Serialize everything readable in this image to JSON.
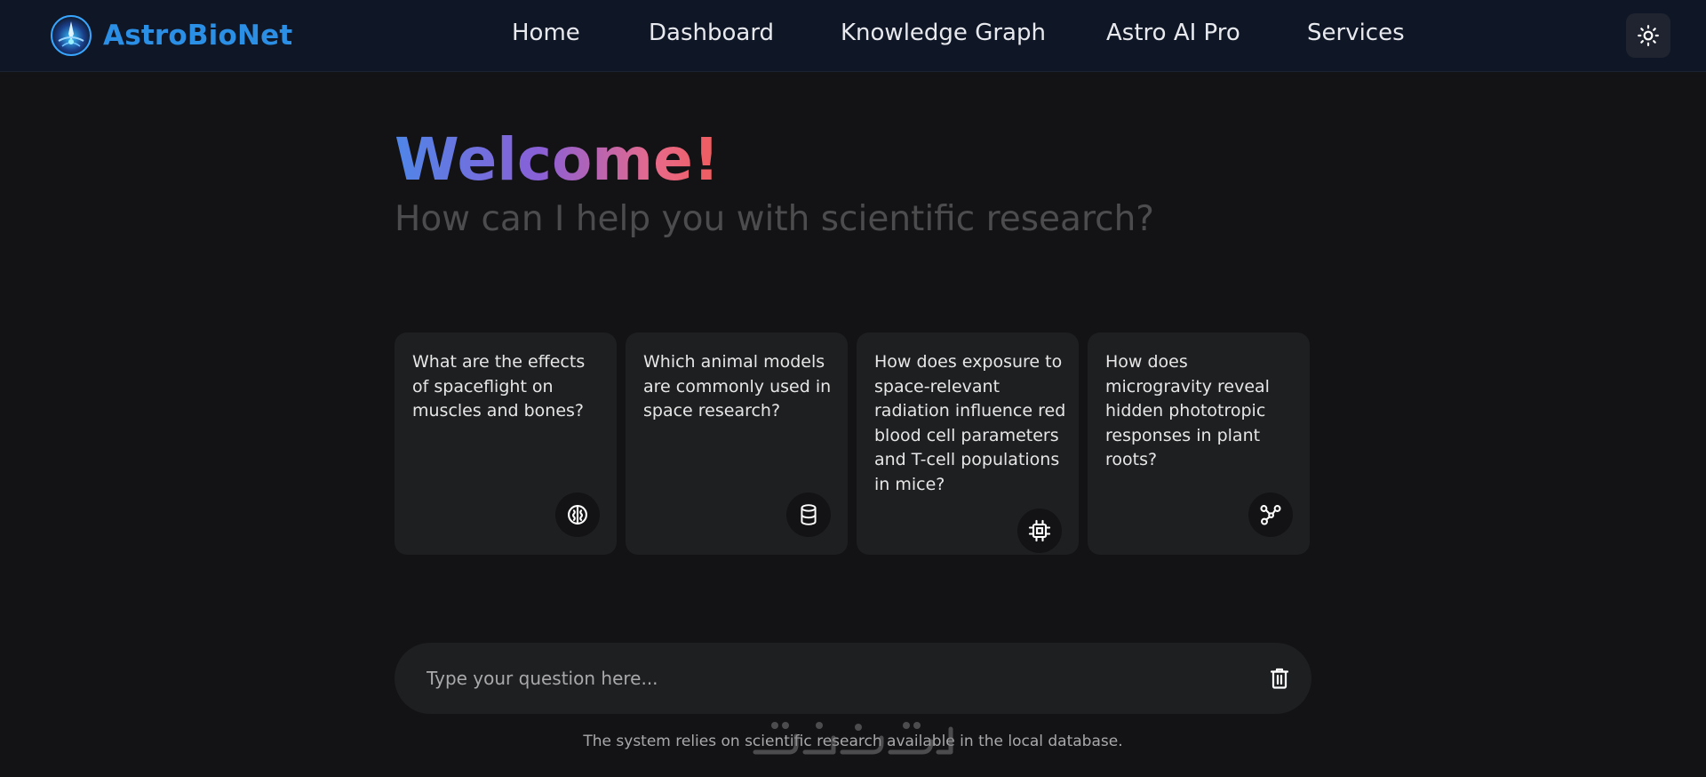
{
  "navbar": {
    "brand": "AstroBioNet",
    "links": [
      "Home",
      "Dashboard",
      "Knowledge Graph",
      "Astro AI Pro",
      "Services"
    ],
    "theme_icon": "sun-icon"
  },
  "hero": {
    "title": "Welcome!",
    "subtitle": "How can I help you with scientific research?"
  },
  "suggestions": [
    {
      "text": "What are the effects of spaceflight on muscles and bones?",
      "icon": "brain-icon"
    },
    {
      "text": "Which animal models are commonly used in space research?",
      "icon": "database-icon"
    },
    {
      "text": "How does exposure to space-relevant radiation influence red blood cell parameters and T-cell populations in mice?",
      "icon": "chip-icon"
    },
    {
      "text": "How does microgravity reveal hidden phototropic responses in plant roots?",
      "icon": "graph-nodes-icon"
    }
  ],
  "prompt": {
    "placeholder": "Type your question here...",
    "value": "",
    "delete_icon": "trash-icon"
  },
  "footer": {
    "disclaimer": "The system relies on scientific research available in the local database."
  },
  "colors": {
    "navbar_bg": "#0f1625",
    "page_bg": "#131315",
    "card_bg": "#1e1f21",
    "brand": "#2b8fe6",
    "welcome_gradient": [
      "#4f86e8",
      "#8a5fd6",
      "#ef5b5b"
    ],
    "subtitle": "#4c4c4e"
  }
}
